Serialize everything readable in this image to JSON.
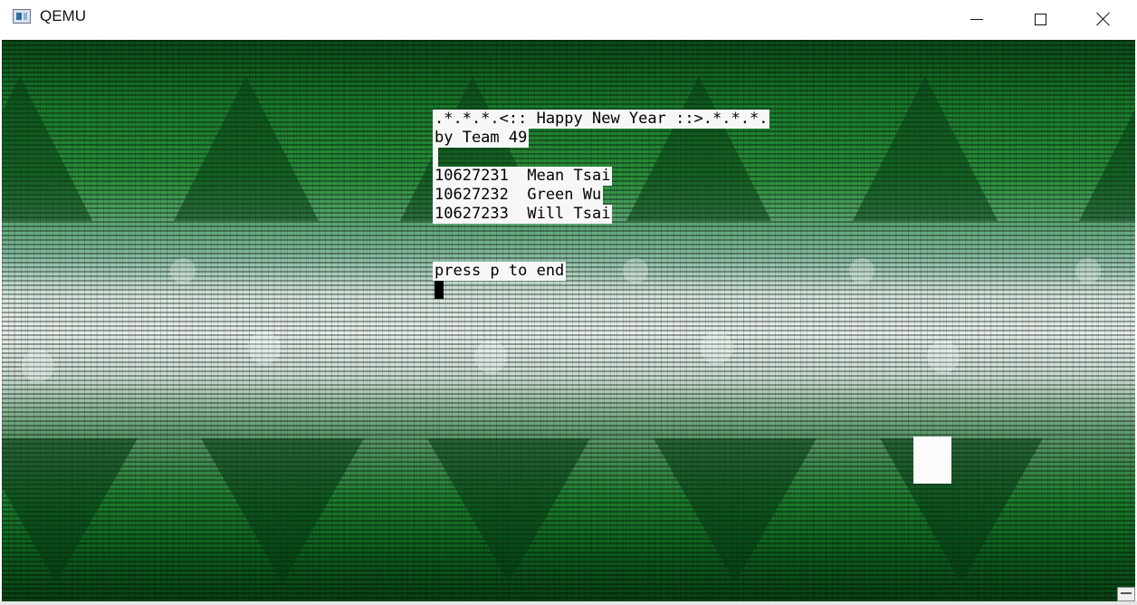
{
  "window": {
    "title": "QEMU",
    "icon": "qemu-app-icon",
    "controls": {
      "minimize_icon": "minimize-icon",
      "maximize_icon": "maximize-icon",
      "close_icon": "close-icon"
    }
  },
  "console": {
    "banner": ".*.*.*.<:: Happy New Year ::>.*.*.*.",
    "byline": "by Team 49",
    "members": [
      "10627231  Mean Tsai",
      "10627232  Green Wu",
      "10627233  Will Tsai"
    ],
    "prompt": "press p to end"
  },
  "colors": {
    "background_green": "#0d5a1d",
    "text": "#000000",
    "text_bg": "#f7f7f7"
  }
}
